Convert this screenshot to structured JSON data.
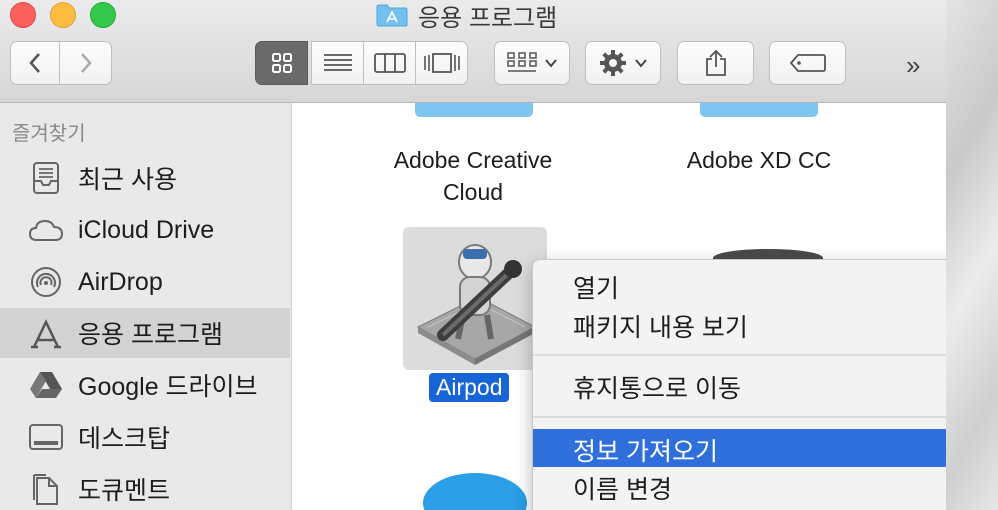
{
  "window": {
    "title": "응용 프로그램",
    "title_icon": "folder-app-icon"
  },
  "toolbar": {
    "back": "‹",
    "forward": "›",
    "overflow": "»",
    "view_buttons": [
      "icon-view-icon",
      "list-view-icon",
      "column-view-icon",
      "cover-flow-icon"
    ],
    "selected_view": "icon-view-icon"
  },
  "sidebar": {
    "heading": "즐겨찾기",
    "items": [
      {
        "label": "최근 사용",
        "icon": "recents-icon"
      },
      {
        "label": "iCloud Drive",
        "icon": "cloud-icon"
      },
      {
        "label": "AirDrop",
        "icon": "airdrop-icon"
      },
      {
        "label": "응용 프로그램",
        "icon": "applications-icon",
        "selected": true
      },
      {
        "label": "Google 드라이브",
        "icon": "google-drive-icon"
      },
      {
        "label": "데스크탑",
        "icon": "desktop-icon"
      },
      {
        "label": "도큐멘트",
        "icon": "document-icon"
      }
    ]
  },
  "files": [
    {
      "name": "Adobe Creative Cloud",
      "line1": "Adobe Creative",
      "line2": "Cloud"
    },
    {
      "name": "Adobe XD CC"
    },
    {
      "name": "Airpod",
      "selected": true
    }
  ],
  "context_menu": {
    "items": [
      {
        "label": "열기"
      },
      {
        "label": "패키지 내용 보기"
      },
      {
        "label": "휴지통으로 이동"
      },
      {
        "label": "정보 가져오기",
        "highlighted": true
      },
      {
        "label": "이름 변경"
      }
    ]
  },
  "colors": {
    "selection": "#1764d6",
    "menu_highlight": "#2f6fdb",
    "folder": "#7ec6f0"
  }
}
